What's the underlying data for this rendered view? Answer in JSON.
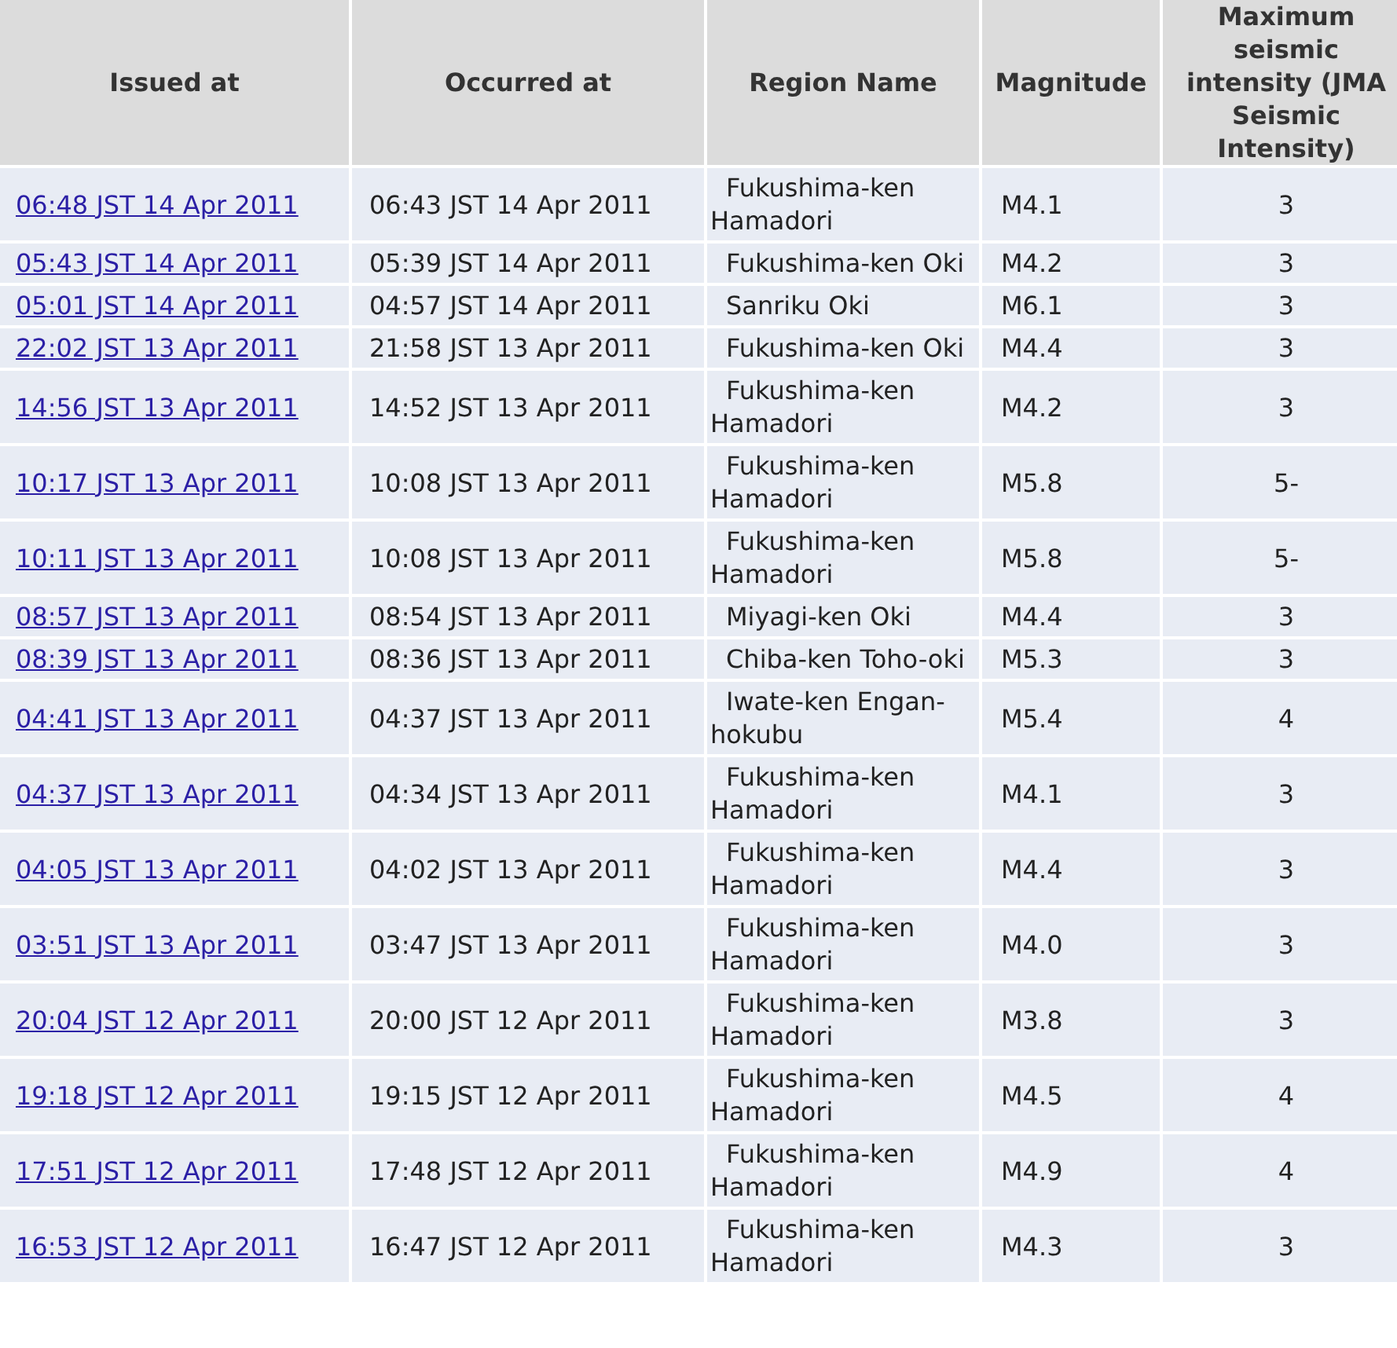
{
  "table": {
    "columns": [
      "Issued at",
      "Occurred at",
      "Region Name",
      "Magnitude",
      "Maximum seismic intensity (JMA Seismic Intensity)"
    ],
    "rows": [
      {
        "issued_at": "06:48 JST 14 Apr 2011",
        "occurred_at": "06:43 JST 14 Apr 2011",
        "region": "Fukushima-ken Hamadori",
        "magnitude": "M4.1",
        "intensity": "3"
      },
      {
        "issued_at": "05:43 JST 14 Apr 2011",
        "occurred_at": "05:39 JST 14 Apr 2011",
        "region": "Fukushima-ken Oki",
        "magnitude": "M4.2",
        "intensity": "3"
      },
      {
        "issued_at": "05:01 JST 14 Apr 2011",
        "occurred_at": "04:57 JST 14 Apr 2011",
        "region": "Sanriku Oki",
        "magnitude": "M6.1",
        "intensity": "3"
      },
      {
        "issued_at": "22:02 JST 13 Apr 2011",
        "occurred_at": "21:58 JST 13 Apr 2011",
        "region": "Fukushima-ken Oki",
        "magnitude": "M4.4",
        "intensity": "3"
      },
      {
        "issued_at": "14:56 JST 13 Apr 2011",
        "occurred_at": "14:52 JST 13 Apr 2011",
        "region": "Fukushima-ken Hamadori",
        "magnitude": "M4.2",
        "intensity": "3"
      },
      {
        "issued_at": "10:17 JST 13 Apr 2011",
        "occurred_at": "10:08 JST 13 Apr 2011",
        "region": "Fukushima-ken Hamadori",
        "magnitude": "M5.8",
        "intensity": "5-"
      },
      {
        "issued_at": "10:11 JST 13 Apr 2011",
        "occurred_at": "10:08 JST 13 Apr 2011",
        "region": "Fukushima-ken Hamadori",
        "magnitude": "M5.8",
        "intensity": "5-"
      },
      {
        "issued_at": "08:57 JST 13 Apr 2011",
        "occurred_at": "08:54 JST 13 Apr 2011",
        "region": "Miyagi-ken Oki",
        "magnitude": "M4.4",
        "intensity": "3"
      },
      {
        "issued_at": "08:39 JST 13 Apr 2011",
        "occurred_at": "08:36 JST 13 Apr 2011",
        "region": "Chiba-ken Toho-oki",
        "magnitude": "M5.3",
        "intensity": "3"
      },
      {
        "issued_at": "04:41 JST 13 Apr 2011",
        "occurred_at": "04:37 JST 13 Apr 2011",
        "region": "Iwate-ken Engan-hokubu",
        "magnitude": "M5.4",
        "intensity": "4"
      },
      {
        "issued_at": "04:37 JST 13 Apr 2011",
        "occurred_at": "04:34 JST 13 Apr 2011",
        "region": "Fukushima-ken Hamadori",
        "magnitude": "M4.1",
        "intensity": "3"
      },
      {
        "issued_at": "04:05 JST 13 Apr 2011",
        "occurred_at": "04:02 JST 13 Apr 2011",
        "region": "Fukushima-ken Hamadori",
        "magnitude": "M4.4",
        "intensity": "3"
      },
      {
        "issued_at": "03:51 JST 13 Apr 2011",
        "occurred_at": "03:47 JST 13 Apr 2011",
        "region": "Fukushima-ken Hamadori",
        "magnitude": "M4.0",
        "intensity": "3"
      },
      {
        "issued_at": "20:04 JST 12 Apr 2011",
        "occurred_at": "20:00 JST 12 Apr 2011",
        "region": "Fukushima-ken Hamadori",
        "magnitude": "M3.8",
        "intensity": "3"
      },
      {
        "issued_at": "19:18 JST 12 Apr 2011",
        "occurred_at": "19:15 JST 12 Apr 2011",
        "region": "Fukushima-ken Hamadori",
        "magnitude": "M4.5",
        "intensity": "4"
      },
      {
        "issued_at": "17:51 JST 12 Apr 2011",
        "occurred_at": "17:48 JST 12 Apr 2011",
        "region": "Fukushima-ken Hamadori",
        "magnitude": "M4.9",
        "intensity": "4"
      },
      {
        "issued_at": "16:53 JST 12 Apr 2011",
        "occurred_at": "16:47 JST 12 Apr 2011",
        "region": "Fukushima-ken Hamadori",
        "magnitude": "M4.3",
        "intensity": "3"
      }
    ]
  }
}
